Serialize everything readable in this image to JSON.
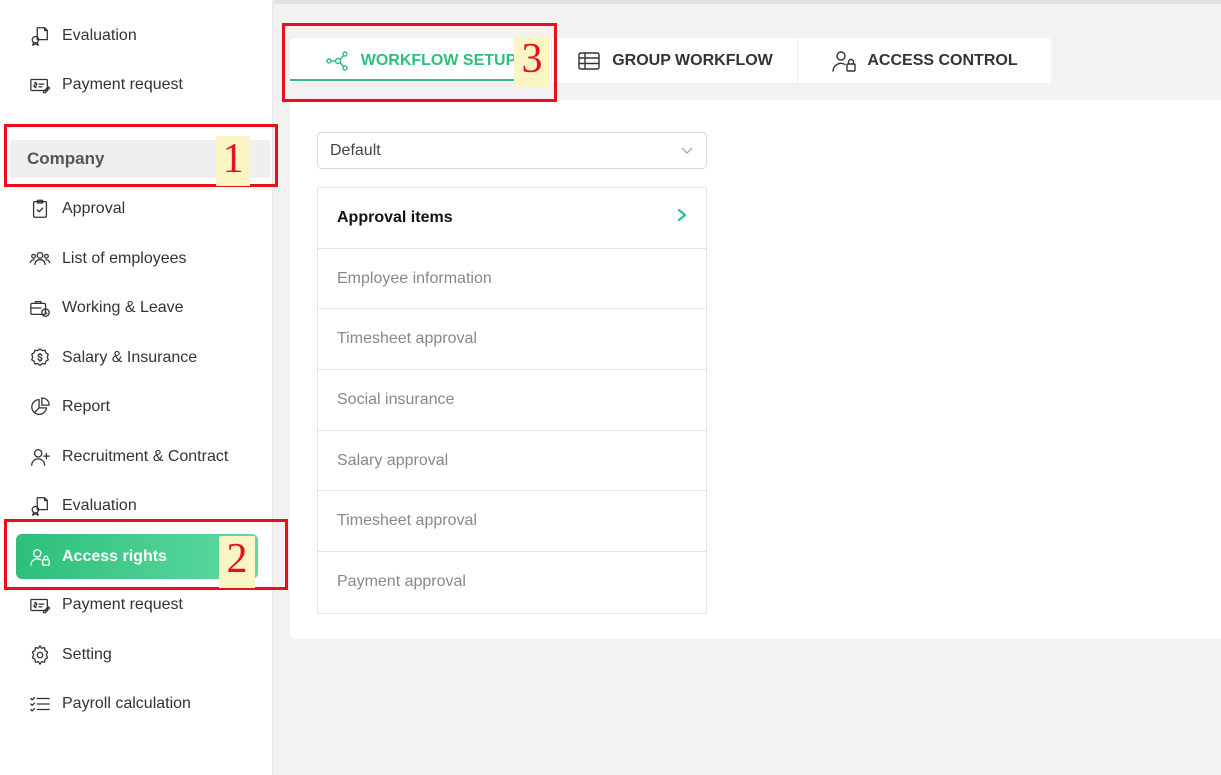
{
  "sidebar": {
    "top_items": [
      {
        "label": "Evaluation",
        "icon": "evaluation-icon"
      },
      {
        "label": "Payment request",
        "icon": "payment-request-icon"
      }
    ],
    "section_title": "Company",
    "items": [
      {
        "label": "Approval",
        "icon": "approval-icon"
      },
      {
        "label": "List of employees",
        "icon": "employees-icon"
      },
      {
        "label": "Working & Leave",
        "icon": "working-leave-icon"
      },
      {
        "label": "Salary & Insurance",
        "icon": "salary-icon"
      },
      {
        "label": "Report",
        "icon": "report-icon"
      },
      {
        "label": "Recruitment & Contract",
        "icon": "recruitment-icon"
      },
      {
        "label": "Evaluation",
        "icon": "evaluation-icon"
      },
      {
        "label": "Access rights",
        "icon": "access-rights-icon",
        "active": true
      },
      {
        "label": "Payment request",
        "icon": "payment-request-icon"
      },
      {
        "label": "Setting",
        "icon": "gear-icon"
      },
      {
        "label": "Payroll calculation",
        "icon": "checklist-icon"
      }
    ]
  },
  "tabs": [
    {
      "label": "WORKFLOW SETUP",
      "icon": "workflow-icon",
      "active": true
    },
    {
      "label": "GROUP WORKFLOW",
      "icon": "table-icon"
    },
    {
      "label": "ACCESS CONTROL",
      "icon": "user-lock-icon"
    }
  ],
  "select": {
    "value": "Default"
  },
  "list": {
    "header": "Approval items",
    "items": [
      "Employee information",
      "Timesheet approval",
      "Social insurance",
      "Salary approval",
      "Timesheet approval",
      "Payment approval"
    ]
  },
  "annotations": {
    "n1": "1",
    "n2": "2",
    "n3": "3"
  },
  "colors": {
    "accent": "#2cbf7a",
    "annotation": "#e8101c",
    "annotation_bg": "#fbf4c4"
  }
}
